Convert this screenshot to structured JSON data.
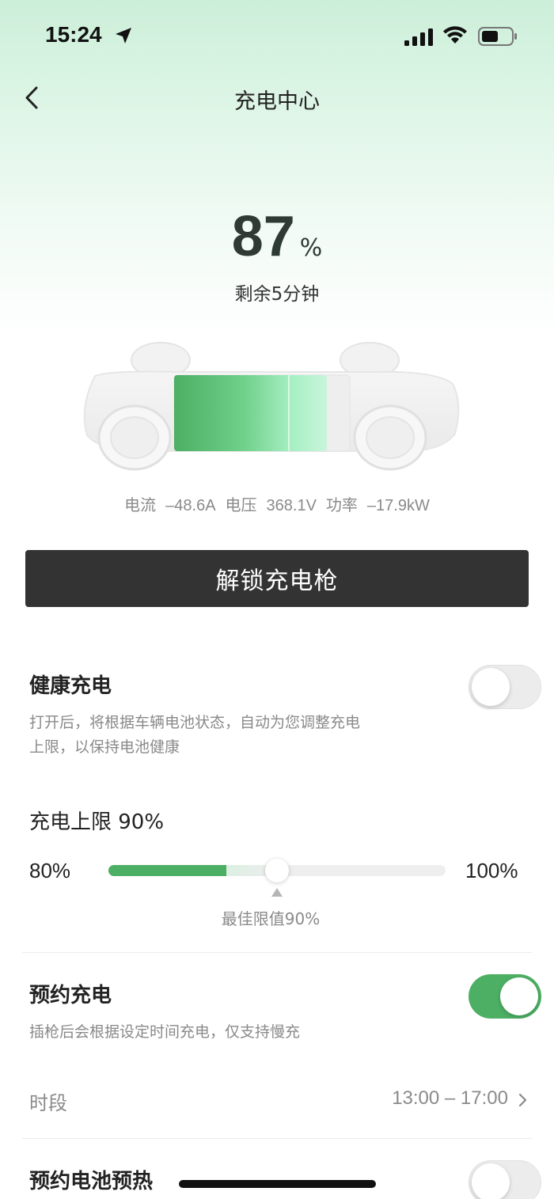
{
  "status_bar": {
    "time": "15:24"
  },
  "nav": {
    "title": "充电中心"
  },
  "charge": {
    "percent": "87",
    "percent_unit": "%",
    "remaining": "剩余5分钟",
    "level_fraction": 0.87
  },
  "metrics": {
    "current_label": "电流",
    "current_value": "–48.6A",
    "voltage_label": "电压",
    "voltage_value": "368.1V",
    "power_label": "功率",
    "power_value": "–17.9kW"
  },
  "unlock_button": "解锁充电枪",
  "healthy_charging": {
    "title": "健康充电",
    "desc_line1": "打开后，将根据车辆电池状态，自动为您调整充电",
    "desc_line2": "上限，以保持电池健康",
    "enabled": false
  },
  "charge_limit": {
    "label": "充电上限 90%",
    "min": "80%",
    "max": "100%",
    "value_percent": 90,
    "best_label": "最佳限值90%"
  },
  "scheduled_charging": {
    "title": "预约充电",
    "desc": "插枪后会根据设定时间充电，仅支持慢充",
    "enabled": true,
    "period_label": "时段",
    "period_value": "13:00 – 17:00"
  },
  "battery_preheat": {
    "title": "预约电池预热",
    "enabled": false
  },
  "colors": {
    "accent": "#4caf63",
    "button_bg": "#333333"
  }
}
